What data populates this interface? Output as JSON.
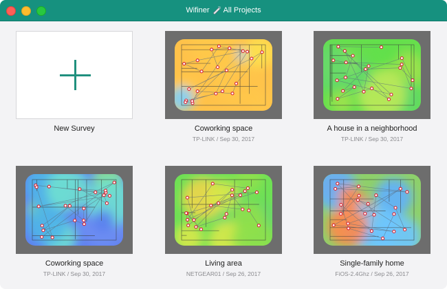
{
  "window": {
    "app_name": "Wifiner",
    "section": "All Projects"
  },
  "new_survey": {
    "label": "New Survey"
  },
  "projects": [
    {
      "title": "Coworking space",
      "router": "TP-LINK",
      "date": "Sep 30, 2017",
      "subtitle": "TP-LINK / Sep 30, 2017",
      "heatmap": "warm"
    },
    {
      "title": "A house in a neighborhood",
      "router": "TP-LINK",
      "date": "Sep 30, 2017",
      "subtitle": "TP-LINK / Sep 30, 2017",
      "heatmap": "green"
    },
    {
      "title": "Coworking space",
      "router": "TP-LINK",
      "date": "Sep 30, 2017",
      "subtitle": "TP-LINK / Sep 30, 2017",
      "heatmap": "blue"
    },
    {
      "title": "Living area",
      "router": "NETGEAR01",
      "date": "Sep 26, 2017",
      "subtitle": "NETGEAR01 / Sep 26, 2017",
      "heatmap": "green-yellow"
    },
    {
      "title": "Single-family home",
      "router": "FiOS-2.4Ghz",
      "date": "Sep 26, 2017",
      "subtitle": "FiOS-2.4Ghz / Sep 26, 2017",
      "heatmap": "mixed"
    }
  ],
  "colors": {
    "titlebar": "#16917f",
    "plus": "#20907e",
    "measure_point": "#d91f2e"
  }
}
